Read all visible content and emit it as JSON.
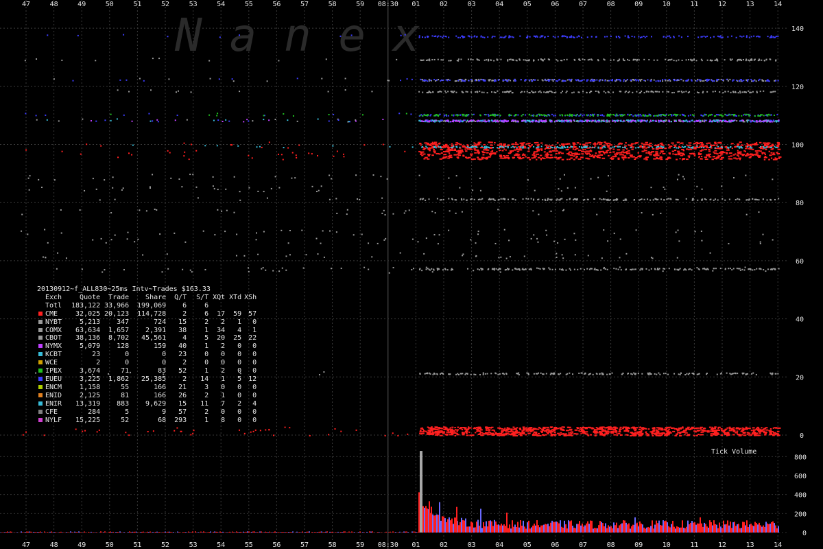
{
  "watermark": "N a n e x",
  "chart_data": {
    "type": "scatter",
    "x_ticks": [
      "47",
      "48",
      "49",
      "50",
      "51",
      "52",
      "53",
      "54",
      "55",
      "56",
      "57",
      "58",
      "59",
      "08:30",
      "01",
      "02",
      "03",
      "04",
      "05",
      "06",
      "07",
      "08",
      "09",
      "10",
      "11",
      "12",
      "13",
      "14"
    ],
    "y_ticks": [
      0,
      20,
      40,
      60,
      80,
      100,
      120,
      140
    ],
    "ylim": [
      -1,
      146
    ],
    "grid": true,
    "series": [
      {
        "name": "CME",
        "color": "#ff2020",
        "level_bands": [
          [
            95,
            100
          ],
          [
            0,
            2
          ]
        ]
      },
      {
        "name": "NYBT",
        "color": "#9a9a9a",
        "level_bands": [
          [
            129,
            129
          ],
          [
            122,
            122
          ],
          [
            118,
            118
          ],
          [
            108,
            108
          ],
          [
            81,
            81
          ],
          [
            57,
            57
          ],
          [
            21,
            21
          ]
        ]
      },
      {
        "name": "EUEU",
        "color": "#3d3dff",
        "level_bands": [
          [
            137,
            137
          ],
          [
            122,
            122
          ],
          [
            110,
            110
          ],
          [
            108,
            108
          ]
        ]
      },
      {
        "name": "ENIR",
        "color": "#38bcd8",
        "level_bands": [
          [
            99,
            99
          ],
          [
            108,
            108
          ]
        ]
      },
      {
        "name": "NYMX",
        "color": "#c040ff",
        "level_bands": [
          [
            108,
            108
          ]
        ]
      },
      {
        "name": "IPEX",
        "color": "#20c020",
        "level_bands": [
          [
            110,
            110
          ]
        ]
      }
    ],
    "volume_panel": {
      "title": "Tick Volume",
      "y_ticks": [
        0,
        200,
        400,
        600,
        800
      ],
      "ylim": [
        0,
        880
      ],
      "peak": 860,
      "spikes": [
        330,
        320,
        270,
        250,
        210,
        160,
        160
      ]
    }
  },
  "stats": {
    "title": "20130912~f_ALL830~25ms Intv~Trades $163.33",
    "headers": [
      "Exch",
      "Quote",
      "Trade",
      "Share",
      "Q/T",
      "S/T",
      "XQt",
      "XTd",
      "XSh"
    ],
    "rows": [
      {
        "color": "",
        "cells": [
          "Totl",
          "183,122",
          "33,966",
          "199,069",
          "6",
          "6",
          "",
          "",
          ""
        ]
      },
      {
        "color": "#ff2020",
        "cells": [
          "CME",
          "32,025",
          "20,123",
          "114,728",
          "2",
          "6",
          "17",
          "59",
          "57"
        ]
      },
      {
        "color": "#9a9a9a",
        "cells": [
          "NYBT",
          "5,213",
          "347",
          "724",
          "15",
          "2",
          "2",
          "1",
          "0"
        ]
      },
      {
        "color": "#9a9a9a",
        "cells": [
          "COMX",
          "63,634",
          "1,657",
          "2,391",
          "38",
          "1",
          "34",
          "4",
          "1"
        ]
      },
      {
        "color": "#9a9a9a",
        "cells": [
          "CBOT",
          "38,136",
          "8,702",
          "45,561",
          "4",
          "5",
          "20",
          "25",
          "22"
        ]
      },
      {
        "color": "#c040ff",
        "cells": [
          "NYMX",
          "5,079",
          "128",
          "159",
          "40",
          "1",
          "2",
          "0",
          "0"
        ]
      },
      {
        "color": "#38bcd8",
        "cells": [
          "KCBT",
          "23",
          "0",
          "0",
          "23",
          "0",
          "0",
          "0",
          "0"
        ]
      },
      {
        "color": "#d0a000",
        "cells": [
          "WCE",
          "2",
          "0",
          "0",
          "2",
          "0",
          "0",
          "0",
          "0"
        ]
      },
      {
        "color": "#20c020",
        "cells": [
          "IPEX",
          "3,674",
          "71",
          "83",
          "52",
          "1",
          "2",
          "0",
          "0"
        ]
      },
      {
        "color": "#3d3dff",
        "cells": [
          "EUEU",
          "3,225",
          "1,862",
          "25,385",
          "2",
          "14",
          "1",
          "5",
          "12"
        ]
      },
      {
        "color": "#b0d000",
        "cells": [
          "ENCM",
          "1,158",
          "55",
          "166",
          "21",
          "3",
          "0",
          "0",
          "0"
        ]
      },
      {
        "color": "#e08020",
        "cells": [
          "ENID",
          "2,125",
          "81",
          "166",
          "26",
          "2",
          "1",
          "0",
          "0"
        ]
      },
      {
        "color": "#38bcd8",
        "cells": [
          "ENIR",
          "13,319",
          "883",
          "9,629",
          "15",
          "11",
          "7",
          "2",
          "4"
        ]
      },
      {
        "color": "#808080",
        "cells": [
          "CFE",
          "284",
          "5",
          "9",
          "57",
          "2",
          "0",
          "0",
          "0"
        ]
      },
      {
        "color": "#d040d0",
        "cells": [
          "NYLF",
          "15,225",
          "52",
          "68",
          "293",
          "1",
          "8",
          "0",
          "0"
        ]
      }
    ]
  }
}
